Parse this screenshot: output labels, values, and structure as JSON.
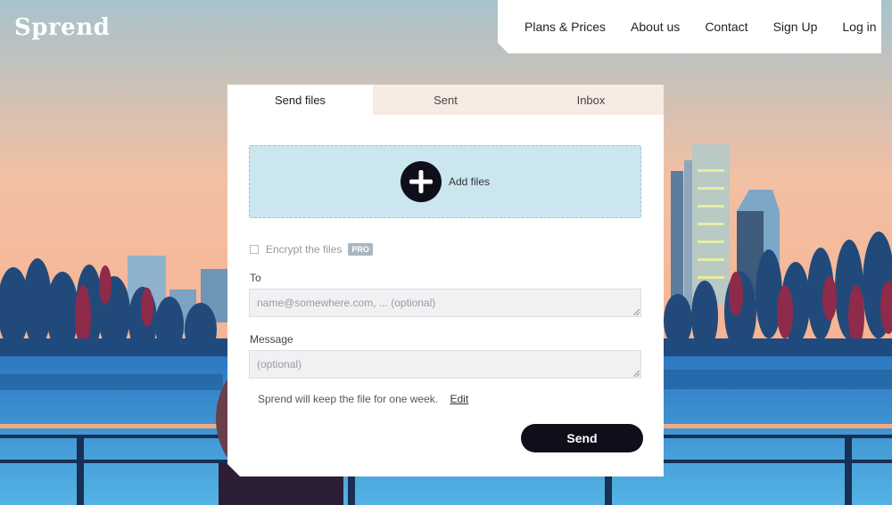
{
  "brand": {
    "logo_text": "Sprend"
  },
  "nav": {
    "items": [
      {
        "label": "Plans & Prices"
      },
      {
        "label": "About us"
      },
      {
        "label": "Contact"
      },
      {
        "label": "Sign Up"
      },
      {
        "label": "Log in"
      }
    ]
  },
  "tabs": [
    {
      "label": "Send files",
      "active": true
    },
    {
      "label": "Sent",
      "active": false
    },
    {
      "label": "Inbox",
      "active": false
    }
  ],
  "upload": {
    "add_label": "Add files",
    "icon": "plus-circle-icon"
  },
  "encrypt": {
    "label": "Encrypt the files",
    "checked": false,
    "badge": "PRO"
  },
  "to_field": {
    "label": "To",
    "value": "",
    "placeholder": "name@somewhere.com, ... (optional)"
  },
  "message_field": {
    "label": "Message",
    "value": "",
    "placeholder": "(optional)"
  },
  "retention": {
    "text": "Sprend will keep the file for one week.",
    "edit_label": "Edit"
  },
  "send_button": {
    "label": "Send"
  },
  "colors": {
    "sky_top": "#a7c3cc",
    "sky_bottom": "#f6b996",
    "water": "#3d8fd0",
    "dropzone": "#cbe6ee",
    "button_dark": "#0e0f1a"
  }
}
